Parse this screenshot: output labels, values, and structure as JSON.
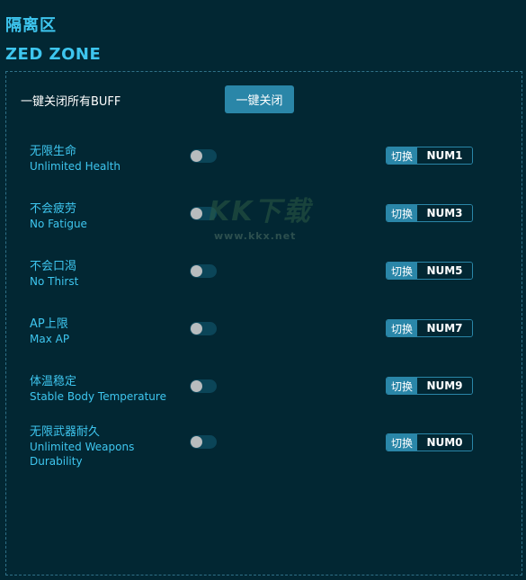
{
  "header": {
    "title_cn": "隔离区",
    "title_en": "ZED ZONE"
  },
  "global": {
    "disable_all_label": "一键关闭所有BUFF",
    "disable_all_button": "一键关闭"
  },
  "cheats": [
    {
      "name_cn": "无限生命",
      "name_en": "Unlimited Health",
      "enabled": false,
      "hotkey_label": "切换",
      "hotkey": "NUM1"
    },
    {
      "name_cn": "不会疲劳",
      "name_en": "No Fatigue",
      "enabled": false,
      "hotkey_label": "切换",
      "hotkey": "NUM3"
    },
    {
      "name_cn": "不会口渴",
      "name_en": "No Thirst",
      "enabled": false,
      "hotkey_label": "切换",
      "hotkey": "NUM5"
    },
    {
      "name_cn": "AP上限",
      "name_en": "Max AP",
      "enabled": false,
      "hotkey_label": "切换",
      "hotkey": "NUM7"
    },
    {
      "name_cn": "体温稳定",
      "name_en": "Stable Body Temperature",
      "enabled": false,
      "hotkey_label": "切换",
      "hotkey": "NUM9"
    },
    {
      "name_cn": "无限武器耐久",
      "name_en": "Unlimited Weapons Durability",
      "enabled": false,
      "hotkey_label": "切换",
      "hotkey": "NUM0"
    }
  ],
  "watermark": {
    "logo": "KK下载",
    "url": "www.kkx.net"
  },
  "colors": {
    "background": "#022733",
    "accent": "#3ec6ef",
    "button": "#2a86a8",
    "toggle_track": "#0b4558",
    "toggle_knob": "#b8bcbe"
  }
}
